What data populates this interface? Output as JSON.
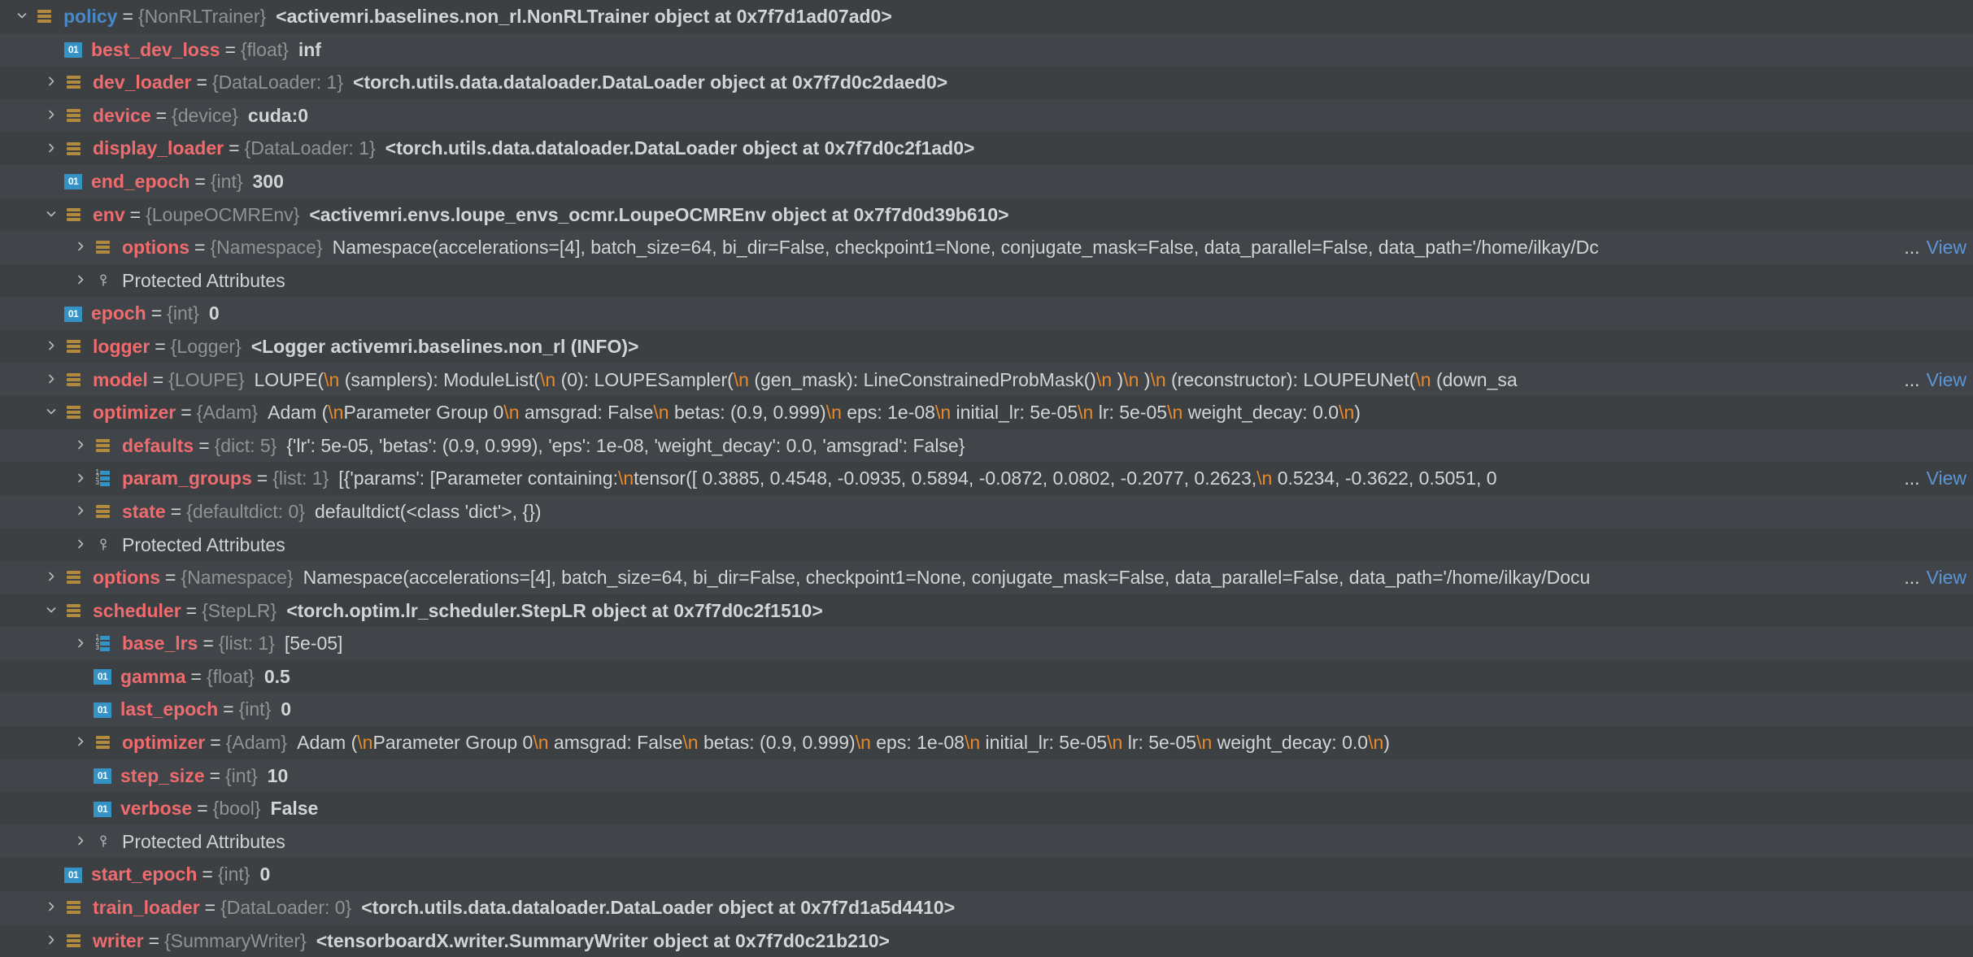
{
  "panel": {
    "name": "debugger-variables-tree",
    "theme_bg": "#3c4043",
    "row_alt_bg": "#414549",
    "name_color": "#ee6b6e",
    "type_color": "#8f9396",
    "value_color": "#d2d4d5",
    "escape_color": "#e8892a",
    "link_color": "#5c96d6"
  },
  "labels": {
    "view": "View",
    "ellipsis": "...",
    "equals": "=",
    "protected_attributes": "Protected Attributes",
    "primitive_icon_text": "01",
    "list_icon_digits": [
      "1",
      "2",
      "3"
    ]
  },
  "rows": [
    {
      "depth": 0,
      "expander": "expanded",
      "icon": "object-icon",
      "name": "policy",
      "name_style": "blue",
      "type": "{NonRLTrainer}",
      "value": "<activemri.baselines.non_rl.NonRLTrainer object at 0x7f7d1ad07ad0>",
      "value_bold": true,
      "view": false
    },
    {
      "depth": 1,
      "expander": "none",
      "icon": "primitive-icon",
      "name": "best_dev_loss",
      "type": "{float}",
      "value": "inf",
      "value_bold": true,
      "view": false
    },
    {
      "depth": 1,
      "expander": "collapsed",
      "icon": "object-icon",
      "name": "dev_loader",
      "type": "{DataLoader: 1}",
      "value": "<torch.utils.data.dataloader.DataLoader object at 0x7f7d0c2daed0>",
      "value_bold": true,
      "view": false
    },
    {
      "depth": 1,
      "expander": "collapsed",
      "icon": "object-icon",
      "name": "device",
      "type": "{device}",
      "value": "cuda:0",
      "value_bold": true,
      "view": false
    },
    {
      "depth": 1,
      "expander": "collapsed",
      "icon": "object-icon",
      "name": "display_loader",
      "type": "{DataLoader: 1}",
      "value": "<torch.utils.data.dataloader.DataLoader object at 0x7f7d0c2f1ad0>",
      "value_bold": true,
      "view": false
    },
    {
      "depth": 1,
      "expander": "none",
      "icon": "primitive-icon",
      "name": "end_epoch",
      "type": "{int}",
      "value": "300",
      "value_bold": true,
      "view": false
    },
    {
      "depth": 1,
      "expander": "expanded",
      "icon": "object-icon",
      "name": "env",
      "type": "{LoupeOCMREnv}",
      "value": "<activemri.envs.loupe_envs_ocmr.LoupeOCMREnv object at 0x7f7d0d39b610>",
      "value_bold": true,
      "view": false
    },
    {
      "depth": 2,
      "expander": "collapsed",
      "icon": "object-icon",
      "name": "options",
      "type": "{Namespace}",
      "value": "Namespace(accelerations=[4], batch_size=64, bi_dir=False, checkpoint1=None, conjugate_mask=False, data_parallel=False, data_path='/home/ilkay/Dc",
      "value_bold": false,
      "truncated": true,
      "view": true
    },
    {
      "depth": 2,
      "expander": "collapsed",
      "icon": "key-icon",
      "plain": "Protected Attributes",
      "view": false
    },
    {
      "depth": 1,
      "expander": "none",
      "icon": "primitive-icon",
      "name": "epoch",
      "type": "{int}",
      "value": "0",
      "value_bold": true,
      "view": false
    },
    {
      "depth": 1,
      "expander": "collapsed",
      "icon": "object-icon",
      "name": "logger",
      "type": "{Logger}",
      "value": "<Logger activemri.baselines.non_rl (INFO)>",
      "value_bold": true,
      "view": false
    },
    {
      "depth": 1,
      "expander": "collapsed",
      "icon": "object-icon",
      "name": "model",
      "type": "{LOUPE}",
      "segments": [
        {
          "t": "LOUPE("
        },
        {
          "esc": "\\n"
        },
        {
          "t": "  (samplers): ModuleList("
        },
        {
          "esc": "\\n"
        },
        {
          "t": "    (0): LOUPESampler("
        },
        {
          "esc": "\\n"
        },
        {
          "t": "      (gen_mask): LineConstrainedProbMask()"
        },
        {
          "esc": "\\n"
        },
        {
          "t": "    )"
        },
        {
          "esc": "\\n"
        },
        {
          "t": "  )"
        },
        {
          "esc": "\\n"
        },
        {
          "t": "  (reconstructor): LOUPEUNet("
        },
        {
          "esc": "\\n"
        },
        {
          "t": "    (down_sa"
        }
      ],
      "truncated": true,
      "view": true
    },
    {
      "depth": 1,
      "expander": "expanded",
      "icon": "object-icon",
      "name": "optimizer",
      "type": "{Adam}",
      "segments": [
        {
          "t": "Adam ("
        },
        {
          "esc": "\\n"
        },
        {
          "t": "Parameter Group 0"
        },
        {
          "esc": "\\n"
        },
        {
          "t": "    amsgrad: False"
        },
        {
          "esc": "\\n"
        },
        {
          "t": "    betas: (0.9, 0.999)"
        },
        {
          "esc": "\\n"
        },
        {
          "t": "    eps: 1e-08"
        },
        {
          "esc": "\\n"
        },
        {
          "t": "    initial_lr: 5e-05"
        },
        {
          "esc": "\\n"
        },
        {
          "t": "    lr: 5e-05"
        },
        {
          "esc": "\\n"
        },
        {
          "t": "    weight_decay: 0.0"
        },
        {
          "esc": "\\n"
        },
        {
          "t": ")"
        }
      ],
      "truncated": false,
      "view": false
    },
    {
      "depth": 2,
      "expander": "collapsed",
      "icon": "object-icon",
      "name": "defaults",
      "type": "{dict: 5}",
      "value": "{'lr': 5e-05, 'betas': (0.9, 0.999), 'eps': 1e-08, 'weight_decay': 0.0, 'amsgrad': False}",
      "value_bold": false,
      "view": false
    },
    {
      "depth": 2,
      "expander": "collapsed",
      "icon": "list-icon",
      "name": "param_groups",
      "type": "{list: 1}",
      "segments": [
        {
          "t": "[{'params': [Parameter containing:"
        },
        {
          "esc": "\\n"
        },
        {
          "t": "tensor([ 0.3885,  0.4548, -0.0935,  0.5894, -0.0872,  0.0802, -0.2077,  0.2623,"
        },
        {
          "esc": "\\n"
        },
        {
          "t": "         0.5234, -0.3622,  0.5051,  0"
        }
      ],
      "truncated": true,
      "view": true
    },
    {
      "depth": 2,
      "expander": "collapsed",
      "icon": "object-icon",
      "name": "state",
      "type": "{defaultdict: 0}",
      "value": "defaultdict(<class 'dict'>, {})",
      "value_bold": false,
      "view": false
    },
    {
      "depth": 2,
      "expander": "collapsed",
      "icon": "key-icon",
      "plain": "Protected Attributes",
      "view": false
    },
    {
      "depth": 1,
      "expander": "collapsed",
      "icon": "object-icon",
      "name": "options",
      "type": "{Namespace}",
      "value": "Namespace(accelerations=[4], batch_size=64, bi_dir=False, checkpoint1=None, conjugate_mask=False, data_parallel=False, data_path='/home/ilkay/Docu",
      "value_bold": false,
      "truncated": true,
      "view": true
    },
    {
      "depth": 1,
      "expander": "expanded",
      "icon": "object-icon",
      "name": "scheduler",
      "type": "{StepLR}",
      "value": "<torch.optim.lr_scheduler.StepLR object at 0x7f7d0c2f1510>",
      "value_bold": true,
      "view": false
    },
    {
      "depth": 2,
      "expander": "collapsed",
      "icon": "list-icon",
      "name": "base_lrs",
      "type": "{list: 1}",
      "value": "[5e-05]",
      "value_bold": false,
      "view": false
    },
    {
      "depth": 2,
      "expander": "none",
      "icon": "primitive-icon",
      "name": "gamma",
      "type": "{float}",
      "value": "0.5",
      "value_bold": true,
      "view": false
    },
    {
      "depth": 2,
      "expander": "none",
      "icon": "primitive-icon",
      "name": "last_epoch",
      "type": "{int}",
      "value": "0",
      "value_bold": true,
      "view": false
    },
    {
      "depth": 2,
      "expander": "collapsed",
      "icon": "object-icon",
      "name": "optimizer",
      "type": "{Adam}",
      "segments": [
        {
          "t": "Adam ("
        },
        {
          "esc": "\\n"
        },
        {
          "t": "Parameter Group 0"
        },
        {
          "esc": "\\n"
        },
        {
          "t": "    amsgrad: False"
        },
        {
          "esc": "\\n"
        },
        {
          "t": "    betas: (0.9, 0.999)"
        },
        {
          "esc": "\\n"
        },
        {
          "t": "    eps: 1e-08"
        },
        {
          "esc": "\\n"
        },
        {
          "t": "    initial_lr: 5e-05"
        },
        {
          "esc": "\\n"
        },
        {
          "t": "    lr: 5e-05"
        },
        {
          "esc": "\\n"
        },
        {
          "t": "    weight_decay: 0.0"
        },
        {
          "esc": "\\n"
        },
        {
          "t": ")"
        }
      ],
      "truncated": false,
      "view": false
    },
    {
      "depth": 2,
      "expander": "none",
      "icon": "primitive-icon",
      "name": "step_size",
      "type": "{int}",
      "value": "10",
      "value_bold": true,
      "view": false
    },
    {
      "depth": 2,
      "expander": "none",
      "icon": "primitive-icon",
      "name": "verbose",
      "type": "{bool}",
      "value": "False",
      "value_bold": true,
      "view": false
    },
    {
      "depth": 2,
      "expander": "collapsed",
      "icon": "key-icon",
      "plain": "Protected Attributes",
      "view": false
    },
    {
      "depth": 1,
      "expander": "none",
      "icon": "primitive-icon",
      "name": "start_epoch",
      "type": "{int}",
      "value": "0",
      "value_bold": true,
      "view": false
    },
    {
      "depth": 1,
      "expander": "collapsed",
      "icon": "object-icon",
      "name": "train_loader",
      "type": "{DataLoader: 0}",
      "value": "<torch.utils.data.dataloader.DataLoader object at 0x7f7d1a5d4410>",
      "value_bold": true,
      "view": false
    },
    {
      "depth": 1,
      "expander": "collapsed",
      "icon": "object-icon",
      "name": "writer",
      "type": "{SummaryWriter}",
      "value": "<tensorboardX.writer.SummaryWriter object at 0x7f7d0c21b210>",
      "value_bold": true,
      "view": false
    }
  ]
}
